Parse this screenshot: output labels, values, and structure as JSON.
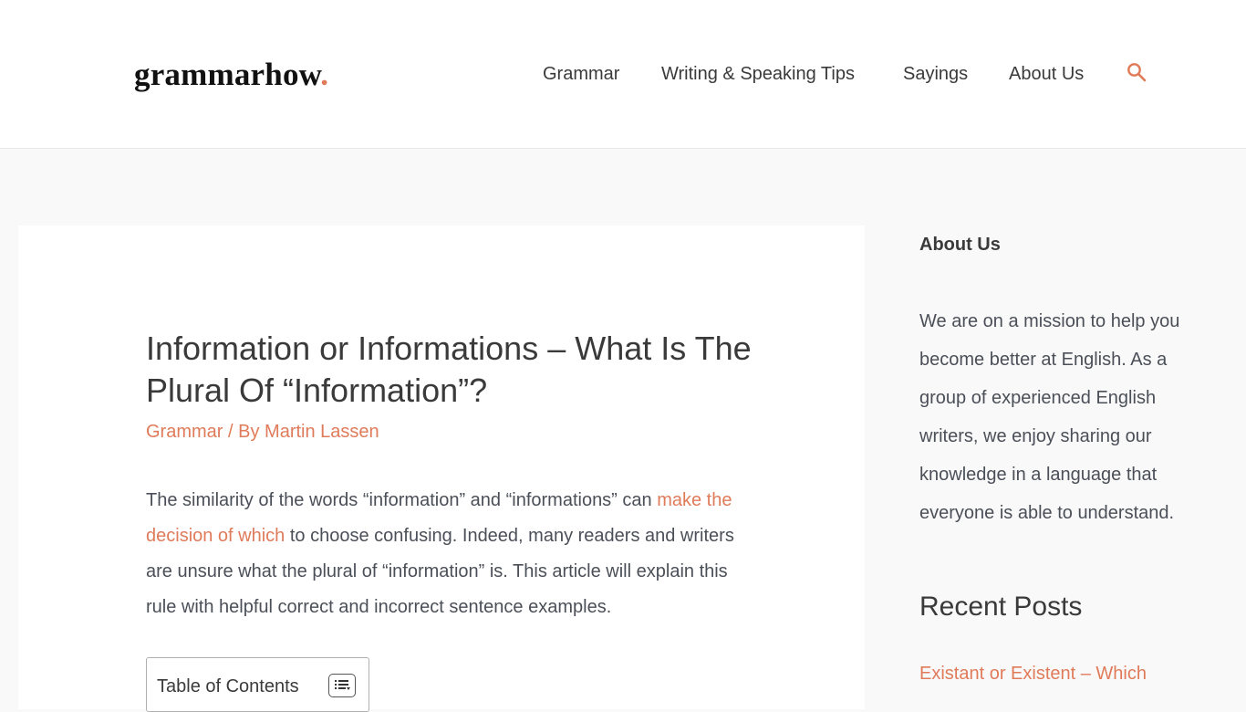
{
  "site": {
    "logo_text": "grammarhow",
    "logo_dot": "."
  },
  "nav": {
    "items": [
      {
        "label": "Grammar"
      },
      {
        "label": "Writing & Speaking Tips"
      },
      {
        "label": "Sayings"
      },
      {
        "label": "About Us"
      }
    ],
    "search_icon": "search-icon"
  },
  "article": {
    "title": "Information or Informations – What Is The Plural Of “Information”?",
    "category": "Grammar",
    "by_separator": " / By ",
    "author": "Martin Lassen",
    "intro_part1": "The similarity of the words “information” and “informations” can ",
    "intro_link": "make the decision of which",
    "intro_part2": " to choose confusing. Indeed, many readers and writers are unsure what the plural of “information” is. This article will explain this rule with helpful correct and incorrect sentence examples.",
    "toc_label": "Table of Contents",
    "toc_icon": "list-toggle-icon"
  },
  "sidebar": {
    "about_heading": "About Us",
    "about_text": "We are on a mission to help you become better at English. As a group of experienced English writers, we enjoy sharing our knowledge in a language that everyone is able to understand.",
    "recent_heading": "Recent Posts",
    "recent_posts": [
      {
        "title": "Existant or Existent – Which"
      }
    ]
  },
  "colors": {
    "accent": "#e07b5a",
    "text": "#3a3a3a",
    "body_text": "#4b4f58",
    "background": "#f9f9f9",
    "surface": "#ffffff"
  }
}
